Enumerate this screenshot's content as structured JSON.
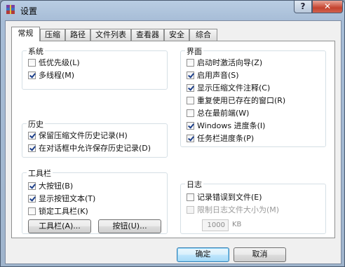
{
  "window": {
    "title": "设置",
    "help_label": "?",
    "close_label": "✕"
  },
  "tabs": [
    {
      "label": "常规",
      "active": true
    },
    {
      "label": "压缩",
      "active": false
    },
    {
      "label": "路径",
      "active": false
    },
    {
      "label": "文件列表",
      "active": false
    },
    {
      "label": "查看器",
      "active": false
    },
    {
      "label": "安全",
      "active": false
    },
    {
      "label": "综合",
      "active": false
    }
  ],
  "groups": {
    "system": {
      "title": "系统",
      "items": [
        {
          "label": "低优先级(L)",
          "checked": false
        },
        {
          "label": "多线程(M)",
          "checked": true
        }
      ]
    },
    "history": {
      "title": "历史",
      "items": [
        {
          "label": "保留压缩文件历史记录(H)",
          "checked": true
        },
        {
          "label": "在对话框中允许保存历史记录(D)",
          "checked": true
        }
      ]
    },
    "toolbar": {
      "title": "工具栏",
      "items": [
        {
          "label": "大按钮(B)",
          "checked": true
        },
        {
          "label": "显示按钮文本(T)",
          "checked": true
        },
        {
          "label": "锁定工具栏(K)",
          "checked": false
        }
      ],
      "toolbar_button": "工具栏(A)...",
      "buttons_button": "按钮(U)..."
    },
    "interface": {
      "title": "界面",
      "items": [
        {
          "label": "启动时激活向导(Z)",
          "checked": false
        },
        {
          "label": "启用声音(S)",
          "checked": true
        },
        {
          "label": "显示压缩文件注释(C)",
          "checked": true
        },
        {
          "label": "重复使用已存在的窗口(R)",
          "checked": false
        },
        {
          "label": "总在最前端(W)",
          "checked": false
        },
        {
          "label": "Windows 进度条(I)",
          "checked": true
        },
        {
          "label": "任务栏进度条(P)",
          "checked": true
        }
      ]
    },
    "log": {
      "title": "日志",
      "items": [
        {
          "label": "记录错误到文件(E)",
          "checked": false,
          "disabled": false
        },
        {
          "label": "限制日志文件大小为(M)",
          "checked": false,
          "disabled": true
        }
      ],
      "size_value": "1000",
      "size_unit": "KB"
    }
  },
  "footer": {
    "ok_label": "确定",
    "cancel_label": "取消"
  }
}
